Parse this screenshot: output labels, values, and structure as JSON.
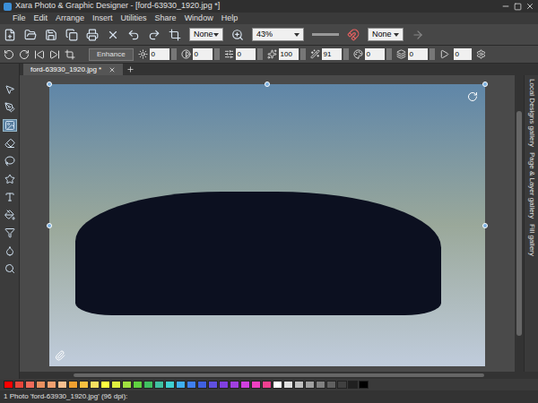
{
  "window": {
    "title": "Xara Photo & Graphic Designer - [ford-63930_1920.jpg *]"
  },
  "menu": [
    "File",
    "Edit",
    "Arrange",
    "Insert",
    "Utilities",
    "Share",
    "Window",
    "Help"
  ],
  "toolbar": {
    "dropdowns": [
      "None",
      "43%",
      "None"
    ]
  },
  "photo_toolbar": {
    "button": "Enhance",
    "fields": [
      "0",
      "0",
      "0",
      "100",
      "91",
      "0",
      "0"
    ],
    "last_field": "0"
  },
  "document_tabs": [
    {
      "label": "ford-63930_1920.jpg *",
      "selected": true
    }
  ],
  "galleries": [
    "Local Designs gallery",
    "Page & Layer gallery",
    "Fill gallery"
  ],
  "palette": [
    "#ff0000",
    "#e8463a",
    "#f06b5a",
    "#e89060",
    "#f0a070",
    "#f8c090",
    "#f0a030",
    "#f8c040",
    "#f8e060",
    "#ffff40",
    "#e0f040",
    "#a0e040",
    "#60d040",
    "#40c060",
    "#40c0a0",
    "#40d0d0",
    "#40b0f0",
    "#4080f0",
    "#4060e0",
    "#6050e0",
    "#8040e0",
    "#a040e0",
    "#d040e0",
    "#f040c0",
    "#f04090",
    "#ffffff",
    "#e0e0e0",
    "#c0c0c0",
    "#a0a0a0",
    "#808080",
    "#606060",
    "#404040",
    "#202020",
    "#000000"
  ],
  "status_bar": "1 Photo 'ford-63930_1920.jpg' (96 dpi):"
}
